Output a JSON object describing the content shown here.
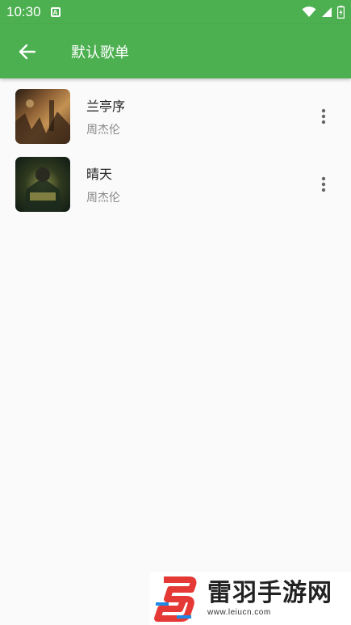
{
  "status_bar": {
    "time": "10:30",
    "notification_icon": "android-a-icon",
    "icons": [
      "wifi-icon",
      "signal-icon",
      "battery-icon"
    ]
  },
  "appbar": {
    "back_icon": "arrow-left-icon",
    "title": "默认歌单",
    "color": "#4caf50"
  },
  "songs": [
    {
      "title": "兰亭序",
      "artist": "周杰伦",
      "cover": "album-cover",
      "menu_icon": "more-vertical-icon"
    },
    {
      "title": "晴天",
      "artist": "周杰伦",
      "cover": "album-cover",
      "menu_icon": "more-vertical-icon"
    }
  ],
  "watermark": {
    "brand": "雷羽手游网",
    "url": "www.leiucn.com"
  }
}
